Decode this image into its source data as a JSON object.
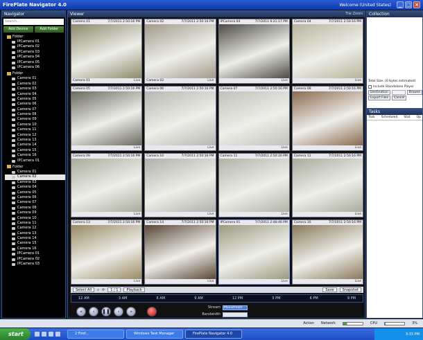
{
  "window": {
    "title": "FirePlate Navigator 4.0",
    "user": "Welcome (United States)"
  },
  "navigator": {
    "title": "Navigator",
    "search_placeholder": "Search...",
    "add_device": "Add Device",
    "add_folder": "Add Folder",
    "groups": [
      {
        "label": "Folder",
        "items": [
          "IPCamera 01",
          "IPCamera 02",
          "IPCamera 03",
          "IPCamera 04",
          "IPCamera 05",
          "IPCamera 06"
        ]
      },
      {
        "label": "Folder",
        "items": [
          "Camera 01",
          "Camera 02",
          "Camera 03",
          "Camera 04",
          "Camera 05",
          "Camera 06",
          "Camera 07",
          "Camera 08",
          "Camera 09",
          "Camera 10",
          "Camera 11",
          "Camera 12",
          "Camera 13",
          "Camera 14",
          "Camera 15",
          "Camera 16",
          "IPCamera 01"
        ]
      },
      {
        "label": "Folder",
        "items": [
          "Camera 01",
          "Camera 02",
          "Camera 03",
          "Camera 04",
          "Camera 05",
          "Camera 06",
          "Camera 07",
          "Camera 08",
          "Camera 09",
          "Camera 10",
          "Camera 11",
          "Camera 12",
          "Camera 13",
          "Camera 14",
          "Camera 15",
          "Camera 16",
          "IPCamera 01",
          "IPCamera 02",
          "IPCamera 03"
        ],
        "selected_index": 1
      }
    ]
  },
  "viewer": {
    "title": "Viewer",
    "header_controls": "Tile  Zoom",
    "tiles": [
      {
        "name": "Camera 01",
        "time": "7/7/2011 2:50:16 PM",
        "footer": "Camera 01",
        "live": "Live",
        "scene": "#8c8a6a"
      },
      {
        "name": "Camera 02",
        "time": "7/7/2011 2:50:16 PM",
        "footer": "Camera 02",
        "live": "Live",
        "scene": "#a29a8a"
      },
      {
        "name": "IPCamera 04",
        "time": "7/7/2011 6:21:17 PM",
        "footer": "",
        "live": "Live",
        "scene": "#4d4a44"
      },
      {
        "name": "Camera 04",
        "time": "7/7/2011 2:50:16 PM",
        "footer": "",
        "live": "Live",
        "scene": "#b8b49a"
      },
      {
        "name": "Camera 05",
        "time": "7/7/2011 2:50:16 PM",
        "footer": "",
        "live": "Live",
        "scene": "#6a6a60"
      },
      {
        "name": "Camera 06",
        "time": "7/7/2011 2:50:16 PM",
        "footer": "",
        "live": "Live",
        "scene": "#b7b7b2"
      },
      {
        "name": "Camera 07",
        "time": "7/7/2011 2:50:16 PM",
        "footer": "",
        "live": "Live",
        "scene": "#c1c1bc"
      },
      {
        "name": "Camera 08",
        "time": "7/7/2011 2:50:16 PM",
        "footer": "",
        "live": "Live",
        "scene": "#8a6a50"
      },
      {
        "name": "Camera 09",
        "time": "7/7/2011 2:50:16 PM",
        "footer": "",
        "live": "Live",
        "scene": "#a8ab9a"
      },
      {
        "name": "Camera 10",
        "time": "7/7/2011 2:50:16 PM",
        "footer": "",
        "live": "Live",
        "scene": "#b0b0aa"
      },
      {
        "name": "Camera 11",
        "time": "7/7/2011 2:50:16 PM",
        "footer": "",
        "live": "Live",
        "scene": "#b1b3a6"
      },
      {
        "name": "Camera 12",
        "time": "7/7/2011 2:50:16 PM",
        "footer": "",
        "live": "Live",
        "scene": "#a9ab9c"
      },
      {
        "name": "Camera 13",
        "time": "7/7/2011 2:50:16 PM",
        "footer": "",
        "live": "Live",
        "scene": "#9a8a64"
      },
      {
        "name": "Camera 14",
        "time": "7/7/2011 2:50:16 PM",
        "footer": "",
        "live": "Live",
        "scene": "#5a4636"
      },
      {
        "name": "IPCamera 01",
        "time": "7/7/2011 2:48:46 PM",
        "footer": "",
        "live": "Live",
        "scene": "#9b9a80",
        "active": true
      },
      {
        "name": "Camera 16",
        "time": "7/7/2011 2:50:16 PM",
        "footer": "",
        "live": "Live",
        "scene": "#8a7a5c"
      }
    ],
    "toolbar": {
      "select_all": "Select All",
      "playback": "Playback",
      "save": "Save",
      "snapshot": "Snapshot",
      "page": "1 / 1"
    },
    "timeline_ticks": [
      "12 AM",
      "3 AM",
      "6 AM",
      "9 AM",
      "12 PM",
      "3 PM",
      "6 PM",
      "9 PM"
    ],
    "stream": {
      "stream_label": "Stream",
      "stream_value": "Mainstream",
      "bandwidth_label": "Bandwidth",
      "bandwidth_value": ""
    }
  },
  "collection": {
    "title": "Collection",
    "total_size": "Total Size: (0 bytes estimated)",
    "include_player": "Include Standalone Player",
    "destination": "Destination",
    "browse": "Browse",
    "export": "Export Files",
    "cancel": "Cancel"
  },
  "tasks": {
    "title": "Tasks",
    "columns": [
      "Task",
      "Scheduled",
      "Stat",
      "Op"
    ]
  },
  "status": {
    "action_label": "Action",
    "network_label": "Network",
    "cpu_label": "CPU",
    "cpu_value": "3%",
    "network_fill": 0.2,
    "cpu_fill": 0.03
  },
  "taskbar": {
    "start": "start",
    "items": [
      "2 Firef...",
      "Windows Task Manager",
      "FirePlate Navigator 4.0"
    ],
    "time": "3:33 PM"
  }
}
